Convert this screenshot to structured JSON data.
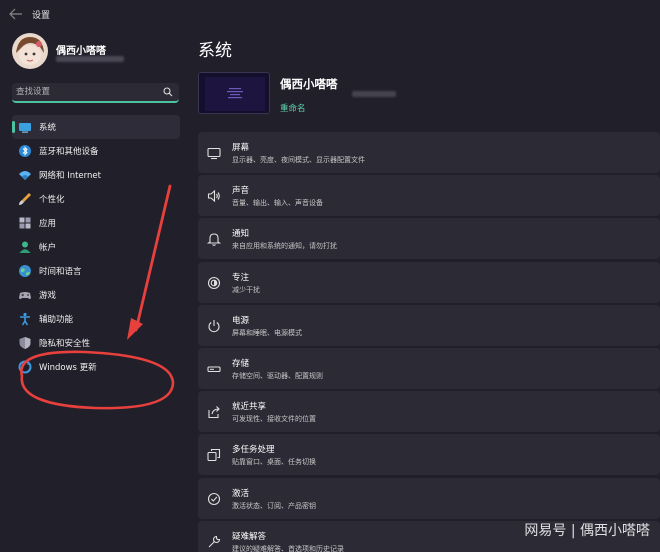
{
  "window": {
    "title": "设置"
  },
  "user": {
    "name": "偶西小嗒嗒"
  },
  "search": {
    "placeholder": "查找设置"
  },
  "sidebar": {
    "items": [
      {
        "label": "系统",
        "icon": "system-icon",
        "active": true
      },
      {
        "label": "蓝牙和其他设备",
        "icon": "bluetooth-icon"
      },
      {
        "label": "网络和 Internet",
        "icon": "wifi-icon"
      },
      {
        "label": "个性化",
        "icon": "brush-icon"
      },
      {
        "label": "应用",
        "icon": "apps-icon"
      },
      {
        "label": "帐户",
        "icon": "account-icon"
      },
      {
        "label": "时间和语言",
        "icon": "globe-icon"
      },
      {
        "label": "游戏",
        "icon": "gamepad-icon"
      },
      {
        "label": "辅助功能",
        "icon": "accessibility-icon"
      },
      {
        "label": "隐私和安全性",
        "icon": "shield-icon"
      },
      {
        "label": "Windows 更新",
        "icon": "windows-update-icon"
      }
    ]
  },
  "main": {
    "title": "系统",
    "device": {
      "name": "偶西小嗒嗒",
      "rename_label": "重命名"
    },
    "cards": [
      {
        "title": "屏幕",
        "subtitle": "显示器、亮度、夜间模式、显示器配置文件",
        "icon": "display-icon"
      },
      {
        "title": "声音",
        "subtitle": "音量、输出、输入、声音设备",
        "icon": "speaker-icon"
      },
      {
        "title": "通知",
        "subtitle": "来自应用和系统的通知，请勿打扰",
        "icon": "bell-icon"
      },
      {
        "title": "专注",
        "subtitle": "减少干扰",
        "icon": "focus-icon"
      },
      {
        "title": "电源",
        "subtitle": "屏幕和睡眠、电源模式",
        "icon": "power-icon"
      },
      {
        "title": "存储",
        "subtitle": "存储空间、驱动器、配置规则",
        "icon": "storage-icon"
      },
      {
        "title": "就近共享",
        "subtitle": "可发现性、接收文件的位置",
        "icon": "share-icon"
      },
      {
        "title": "多任务处理",
        "subtitle": "贴靠窗口、桌面、任务切换",
        "icon": "multitask-icon"
      },
      {
        "title": "激活",
        "subtitle": "激活状态、订阅、产品密钥",
        "icon": "activation-icon"
      },
      {
        "title": "疑难解答",
        "subtitle": "建议的疑难解答、首选项和历史记录",
        "icon": "wrench-icon"
      }
    ]
  },
  "watermark": "网易号 | 偶西小嗒嗒",
  "colors": {
    "accent": "#4cc2a0",
    "annotation": "#e8403c",
    "background": "#201f2a",
    "card": "#2b2a35"
  }
}
